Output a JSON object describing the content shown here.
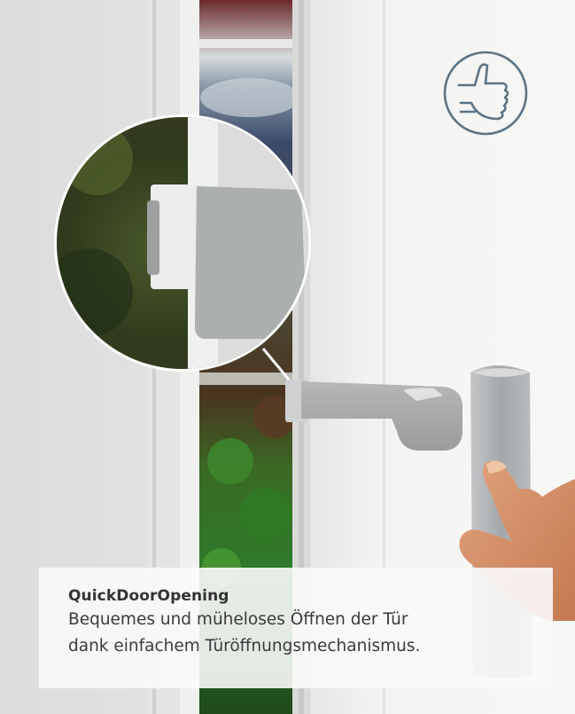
{
  "feature": {
    "icon": "thumbs-up-icon",
    "title": "QuickDoorOpening",
    "line1": "Bequemes und müheloses Öffnen der Tür",
    "line2": "dank einfachem Türöffnungsmechanismus."
  },
  "colors": {
    "icon_stroke": "#5d7383",
    "handle": "#a7a9ab",
    "door_white": "#f1f1f0"
  }
}
